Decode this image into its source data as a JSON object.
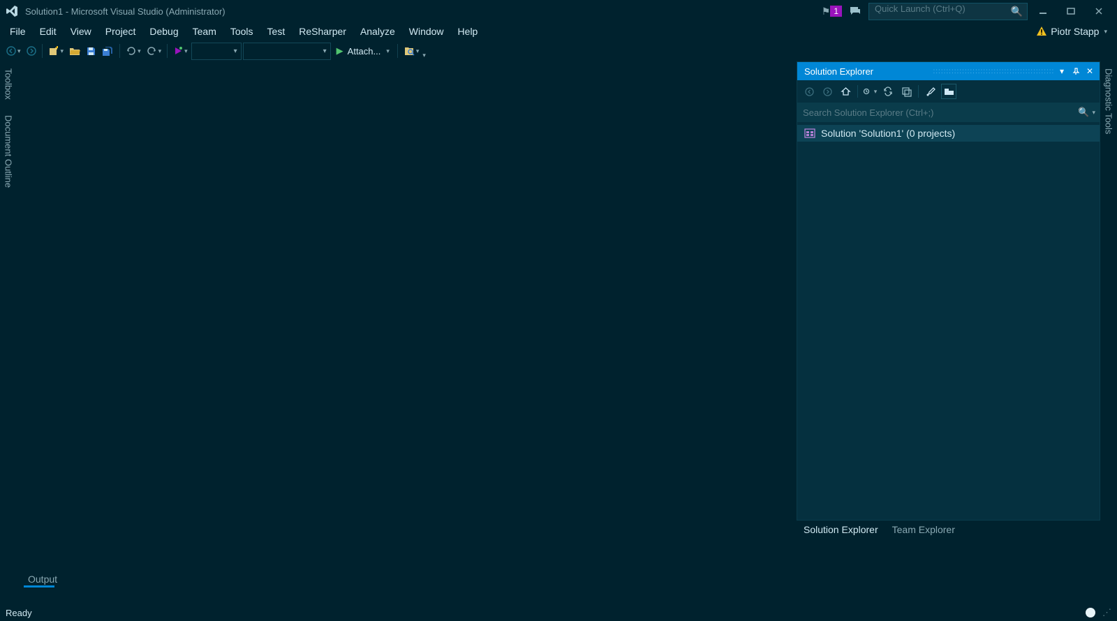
{
  "titlebar": {
    "title": "Solution1 - Microsoft Visual Studio (Administrator)",
    "notification_count": "1",
    "quick_launch_placeholder": "Quick Launch (Ctrl+Q)"
  },
  "menu": {
    "items": [
      "File",
      "Edit",
      "View",
      "Project",
      "Debug",
      "Team",
      "Tools",
      "Test",
      "ReSharper",
      "Analyze",
      "Window",
      "Help"
    ],
    "user": "Piotr Stapp"
  },
  "toolbar": {
    "attach_label": "Attach...",
    "config_combo_value": "",
    "platform_combo_value": ""
  },
  "left_rail": {
    "tabs": [
      "Toolbox",
      "Document Outline"
    ]
  },
  "right_rail": {
    "tab": "Diagnostic Tools"
  },
  "solution_explorer": {
    "title": "Solution Explorer",
    "search_placeholder": "Search Solution Explorer (Ctrl+;)",
    "root_label": "Solution 'Solution1' (0 projects)",
    "tabs": [
      "Solution Explorer",
      "Team Explorer"
    ]
  },
  "bottom": {
    "output_tab": "Output"
  },
  "statusbar": {
    "status": "Ready"
  }
}
